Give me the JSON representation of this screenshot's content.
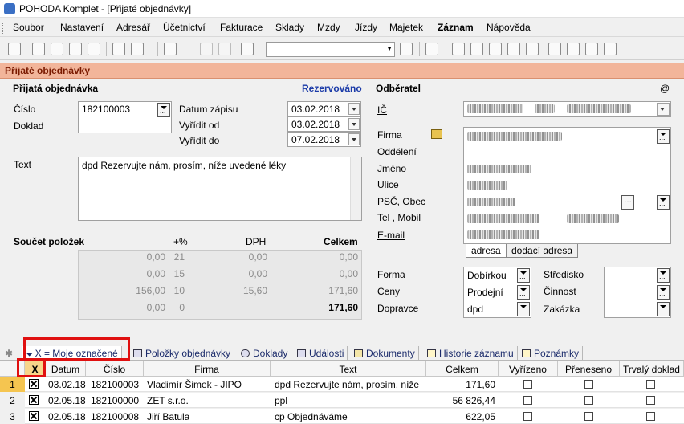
{
  "window": {
    "title": "POHODA Komplet - [Přijaté objednávky]"
  },
  "menu": [
    "Soubor",
    "Nastavení",
    "Adresář",
    "Účetnictví",
    "Fakturace",
    "Sklady",
    "Mzdy",
    "Jízdy",
    "Majetek",
    "Záznam",
    "Nápověda"
  ],
  "agenda_title": "Přijaté objednávky",
  "order": {
    "section_title": "Přijatá objednávka",
    "status": "Rezervováno",
    "cislo_label": "Číslo",
    "cislo_value": "182100003",
    "doklad_label": "Doklad",
    "datum_zapisu_label": "Datum zápisu",
    "datum_zapisu": "03.02.2018",
    "vyridit_od_label": "Vyřídit od",
    "vyridit_od": "03.02.2018",
    "vyridit_do_label": "Vyřídit do",
    "vyridit_do": "07.02.2018",
    "text_label": "Text",
    "text_value": "dpd Rezervujte nám, prosím, níže uvedené léky"
  },
  "sums": {
    "title": "Součet položek",
    "col_pct": "+%",
    "col_dph": "DPH",
    "col_total": "Celkem",
    "rows": [
      {
        "base": "0,00",
        "pct": "21",
        "dph": "0,00",
        "total": "0,00"
      },
      {
        "base": "0,00",
        "pct": "15",
        "dph": "0,00",
        "total": "0,00"
      },
      {
        "base": "156,00",
        "pct": "10",
        "dph": "15,60",
        "total": "171,60"
      },
      {
        "base": "0,00",
        "pct": "0",
        "dph": "",
        "total": "171,60"
      }
    ]
  },
  "customer": {
    "title": "Odběratel",
    "at": "@",
    "ic_label": "IČ",
    "firma_label": "Firma",
    "oddeleni_label": "Oddělení",
    "jmeno_label": "Jméno",
    "ulice_label": "Ulice",
    "psc_label": "PSČ, Obec",
    "tel_label": "Tel , Mobil",
    "email_label": "E-mail",
    "tab_adresa": "adresa",
    "tab_dodaci": "dodací adresa"
  },
  "footer_fields": {
    "forma_label": "Forma",
    "forma_value": "Dobírkou",
    "ceny_label": "Ceny",
    "ceny_value": "Prodejní",
    "dopravce_label": "Dopravce",
    "dopravce_value": "dpd",
    "stredisko_label": "Středisko",
    "cinnost_label": "Činnost",
    "zakazka_label": "Zakázka"
  },
  "tabs": [
    "X = Moje označené",
    "Položky objednávky",
    "Doklady",
    "Události",
    "Dokumenty",
    "Historie záznamu",
    "Poznámky"
  ],
  "table": {
    "headers": [
      "X",
      "Datum",
      "Číslo",
      "Firma",
      "Text",
      "Celkem",
      "Vyřízeno",
      "Přeneseno",
      "Trvalý doklad"
    ],
    "rows": [
      {
        "n": "1",
        "datum": "03.02.18",
        "cislo": "182100003",
        "firma": "Vladimír Šimek - JIPO",
        "text": "dpd Rezervujte nám, prosím, níže",
        "celkem": "171,60"
      },
      {
        "n": "2",
        "datum": "02.05.18",
        "cislo": "182100000",
        "firma": "ZET s.r.o.",
        "text": "ppl",
        "celkem": "56 826,44"
      },
      {
        "n": "3",
        "datum": "02.05.18",
        "cislo": "182100008",
        "firma": "Jiří Batula",
        "text": "cp Objednáváme",
        "celkem": "622,05"
      }
    ]
  },
  "colors": {
    "agenda_bar": "#f2b59a",
    "status": "#1a3aa8",
    "highlight": "#e01010"
  }
}
